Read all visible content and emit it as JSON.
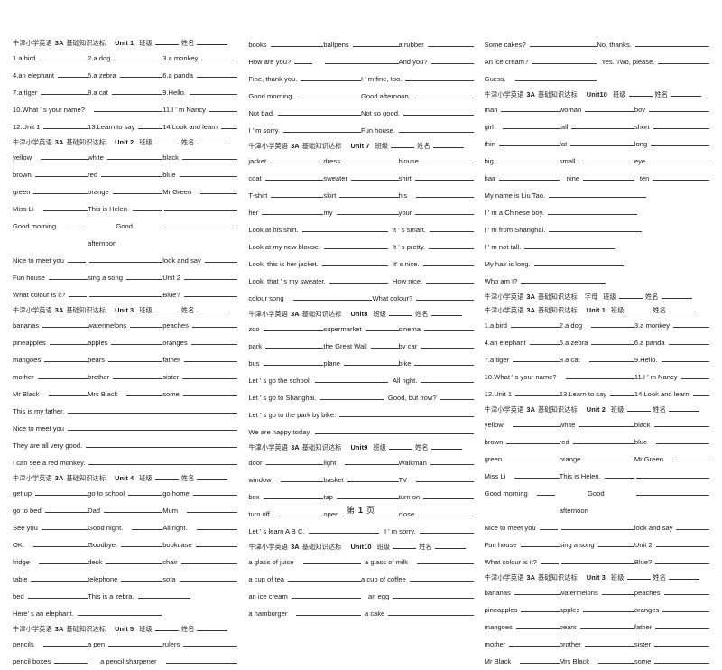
{
  "document": {
    "title_cn": "牛津小学英语",
    "level": "3A",
    "subtitle_cn": "基础知识达标",
    "class_label_cn": "班级",
    "name_label_cn": "姓名",
    "letters_label_cn": "字母",
    "footer": {
      "prefix_cn": "第",
      "page": "1",
      "suffix_cn": "页"
    }
  },
  "units": {
    "u1": "Unit 1",
    "u2": "Unit 2",
    "u3": "Unit 3",
    "u4": "Unit 4",
    "u5": "Unit 5",
    "u7": "Unit 7",
    "u8": "Unit8",
    "u9": "Unit9",
    "u10": "Unit10"
  },
  "unit1": {
    "items": [
      "1.a bird",
      "2.a dog",
      "3.a monkey",
      "4.an elephant",
      "5.a zebra",
      "6.a panda",
      "7.a tiger",
      "8.a cat",
      "9.Hello."
    ],
    "q10": "10.What ' s your name?",
    "q11": "11.I ' m Nancy",
    "q12": "12.Unit 1",
    "q13": "13.Learn to say",
    "q14": "14.Look and learn"
  },
  "unit2": {
    "colors": [
      "yellow",
      "white",
      "black",
      "brown",
      "red",
      "blue",
      "green",
      "orange",
      "Mr Green"
    ],
    "miss_li": "Miss Li",
    "this_is_helen": "This is Helen.",
    "good_morning": "Good morning",
    "good": "Good",
    "afternoon": "afternoon",
    "nice_to_meet_you": "Nice to meet you",
    "look_and_say": "look and say",
    "fun_house": "Fun house",
    "sing_a_song": "sing a song",
    "unit2_label": "Unit 2",
    "what_colour": "What colour is it?",
    "blue_q": "Blue?"
  },
  "unit3": {
    "items": [
      "bananas",
      "watermelons",
      "peaches",
      "pineapples",
      "apples",
      "oranges",
      "mangoes",
      "pears",
      "father",
      "mother",
      "brother",
      "sister",
      "Mr Black",
      "Mrs Black",
      "some"
    ],
    "s1": "This is my father.",
    "s2": "Nice to meet you",
    "s3": "They are all very good.",
    "s4": "I can see a red monkey."
  },
  "unit4": {
    "items": [
      "get up",
      "go to school",
      "go home",
      "go to bed",
      "Dad",
      "Mum",
      "See you",
      "Good night.",
      "All right.",
      "OK.",
      "Goodbye.",
      "bookcase",
      "fridge",
      "desk",
      "chair",
      "table",
      "telephone",
      "sofa"
    ],
    "bed": "bed",
    "this_is_a_zebra": "This is a zebra.",
    "heres_an_elephant": "Here' s an elephant."
  },
  "unit5": {
    "pencils": "pencils",
    "a_pen": "a pen",
    "rulers": "rulers",
    "pencil_boxes": "pencil boxes",
    "a_pencil_sharpener": "a pencil sharpener"
  },
  "unit6": {
    "books": "books",
    "ballpens": "ballpens",
    "a_rubber": "a rubber",
    "how_are_you": "How are you?",
    "and_you": "And you?",
    "fine_thank_you": "Fine, thank you.",
    "im_fine_too": "I ' m fine, too.",
    "good_morning": "Good morning.",
    "good_afternoon": "Good afternoon.",
    "not_bad": "Not bad.",
    "not_so_good": "Not so good.",
    "im_sorry": "I ' m sorry.",
    "fun_house": "Fun house."
  },
  "unit7": {
    "items": [
      "jacket",
      "dress",
      "blouse",
      "coat",
      "sweater",
      "shirt",
      "T-shirt",
      "skirt",
      "his",
      "her",
      "my",
      "your"
    ],
    "s1_q": "Look at his shirt.",
    "s1_a": "It ' s smart.",
    "s2_q": "Look at my new blouse.",
    "s2_a": "It ' s pretty.",
    "s3_q": "Look, this is her jacket.",
    "s3_a": "It' s nice.",
    "s4_q": "Look, that ' s my sweater.",
    "s4_a": "How nice.",
    "colour_song": "colour song",
    "what_colour": "What colour?"
  },
  "unit8": {
    "items": [
      "zoo",
      "supermarket",
      "cinema",
      "park",
      "the Great Wall",
      "by car",
      "bus",
      "plane",
      "bike"
    ],
    "s1_q": "Let ' s go the school.",
    "s1_a": "All right.",
    "s2_q": "Let ' s go to Shanghai.",
    "s2_a": "Good, but how?",
    "s3": "Let ' s go to the park by bike.",
    "s4": "We are happy today."
  },
  "unit9": {
    "items": [
      "door",
      "light",
      "Walkman",
      "window",
      "basket",
      "TV",
      "box",
      "tap",
      "turn on",
      "turn off",
      "open",
      "close"
    ],
    "s1_q": "Let ' s learn A B C.",
    "s1_a": "I ' m sorry."
  },
  "unit10": {
    "a_glass_of_juice": "a glass of juice",
    "a_glass_of_milk": "a glass of milk",
    "a_cup_of_tea": "a cup of tea",
    "a_cup_of_coffee": "a cup of coffee",
    "an_ice_cream": "an ice cream",
    "an_egg": "an egg",
    "a_hamburger": "a hamburger",
    "a_cake": "a cake",
    "some_cakes_q": "Some cakes?",
    "no_thanks": "No, thanks.",
    "an_ice_cream_q": "An ice cream?",
    "yes_two_please": "Yes. Two, please.",
    "guess": "Guess."
  },
  "unit10b": {
    "items": [
      "man",
      "woman",
      "boy",
      "girl",
      "tall",
      "short",
      "thin",
      "fat",
      "long",
      "big",
      "small",
      "eye",
      "hair",
      "nine",
      "ten"
    ],
    "s1": "My name is Liu Tao.",
    "s2": "I ' m a Chinese boy.",
    "s3": "I ' m from Shanghai.",
    "s4": "I ' m not tall.",
    "s5": "My hair is long.",
    "s6": "Who am I?"
  }
}
